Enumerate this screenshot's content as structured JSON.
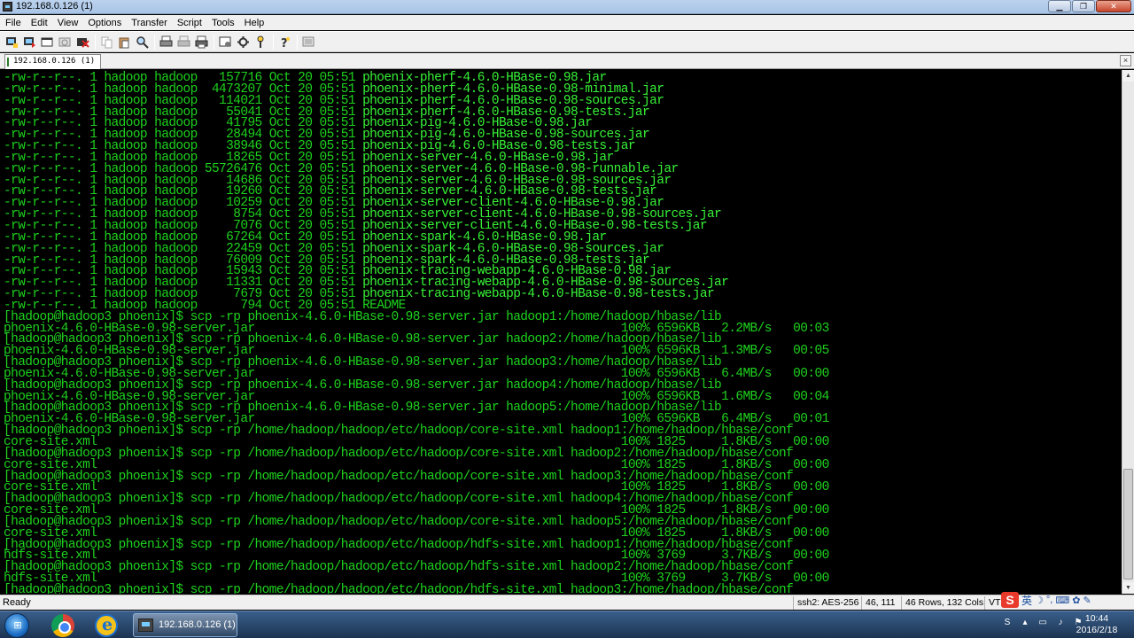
{
  "window": {
    "title": "192.168.0.126 (1)"
  },
  "menu": [
    "File",
    "Edit",
    "View",
    "Options",
    "Transfer",
    "Script",
    "Tools",
    "Help"
  ],
  "toolbar": {
    "icons": [
      "connect-icon",
      "quick-connect-icon",
      "connect-tab-icon",
      "reconnect-icon",
      "disconnect-icon",
      "copy-icon",
      "paste-icon",
      "find-icon",
      "print-icon",
      "print-setup-icon",
      "print-screen-icon",
      "session-options-icon",
      "global-options-icon",
      "keymap-icon",
      "help-icon",
      "sftp-icon"
    ]
  },
  "tab": {
    "label": "192.168.0.126 (1)",
    "close_glyph": "×"
  },
  "terminal": {
    "lines": [
      {
        "plain": "-rw-r--r--. 1 hadoop hadoop   157716 Oct 20 05:51 ",
        "file": "phoenix-pherf-4.6.0-HBase-0.98.jar"
      },
      {
        "plain": "-rw-r--r--. 1 hadoop hadoop  4473207 Oct 20 05:51 ",
        "file": "phoenix-pherf-4.6.0-HBase-0.98-minimal.jar"
      },
      {
        "plain": "-rw-r--r--. 1 hadoop hadoop   114021 Oct 20 05:51 ",
        "file": "phoenix-pherf-4.6.0-HBase-0.98-sources.jar"
      },
      {
        "plain": "-rw-r--r--. 1 hadoop hadoop    55041 Oct 20 05:51 ",
        "file": "phoenix-pherf-4.6.0-HBase-0.98-tests.jar"
      },
      {
        "plain": "-rw-r--r--. 1 hadoop hadoop    41795 Oct 20 05:51 ",
        "file": "phoenix-pig-4.6.0-HBase-0.98.jar"
      },
      {
        "plain": "-rw-r--r--. 1 hadoop hadoop    28494 Oct 20 05:51 ",
        "file": "phoenix-pig-4.6.0-HBase-0.98-sources.jar"
      },
      {
        "plain": "-rw-r--r--. 1 hadoop hadoop    38946 Oct 20 05:51 ",
        "file": "phoenix-pig-4.6.0-HBase-0.98-tests.jar"
      },
      {
        "plain": "-rw-r--r--. 1 hadoop hadoop    18265 Oct 20 05:51 ",
        "file": "phoenix-server-4.6.0-HBase-0.98.jar"
      },
      {
        "plain": "-rw-r--r--. 1 hadoop hadoop 55726476 Oct 20 05:51 ",
        "file": "phoenix-server-4.6.0-HBase-0.98-runnable.jar"
      },
      {
        "plain": "-rw-r--r--. 1 hadoop hadoop    14686 Oct 20 05:51 ",
        "file": "phoenix-server-4.6.0-HBase-0.98-sources.jar"
      },
      {
        "plain": "-rw-r--r--. 1 hadoop hadoop    19260 Oct 20 05:51 ",
        "file": "phoenix-server-4.6.0-HBase-0.98-tests.jar"
      },
      {
        "plain": "-rw-r--r--. 1 hadoop hadoop    10259 Oct 20 05:51 ",
        "file": "phoenix-server-client-4.6.0-HBase-0.98.jar"
      },
      {
        "plain": "-rw-r--r--. 1 hadoop hadoop     8754 Oct 20 05:51 ",
        "file": "phoenix-server-client-4.6.0-HBase-0.98-sources.jar"
      },
      {
        "plain": "-rw-r--r--. 1 hadoop hadoop     7076 Oct 20 05:51 ",
        "file": "phoenix-server-client-4.6.0-HBase-0.98-tests.jar"
      },
      {
        "plain": "-rw-r--r--. 1 hadoop hadoop    67264 Oct 20 05:51 ",
        "file": "phoenix-spark-4.6.0-HBase-0.98.jar"
      },
      {
        "plain": "-rw-r--r--. 1 hadoop hadoop    22459 Oct 20 05:51 ",
        "file": "phoenix-spark-4.6.0-HBase-0.98-sources.jar"
      },
      {
        "plain": "-rw-r--r--. 1 hadoop hadoop    76009 Oct 20 05:51 ",
        "file": "phoenix-spark-4.6.0-HBase-0.98-tests.jar"
      },
      {
        "plain": "-rw-r--r--. 1 hadoop hadoop    15943 Oct 20 05:51 ",
        "file": "phoenix-tracing-webapp-4.6.0-HBase-0.98.jar"
      },
      {
        "plain": "-rw-r--r--. 1 hadoop hadoop    11331 Oct 20 05:51 ",
        "file": "phoenix-tracing-webapp-4.6.0-HBase-0.98-sources.jar"
      },
      {
        "plain": "-rw-r--r--. 1 hadoop hadoop     7679 Oct 20 05:51 ",
        "file": "phoenix-tracing-webapp-4.6.0-HBase-0.98-tests.jar"
      },
      {
        "plain": "-rw-r--r--. 1 hadoop hadoop      794 Oct 20 05:51 README",
        "file": ""
      },
      {
        "plain": "[hadoop@hadoop3 phoenix]$ scp -rp phoenix-4.6.0-HBase-0.98-server.jar hadoop1:/home/hadoop/hbase/lib",
        "file": ""
      },
      {
        "plain": "phoenix-4.6.0-HBase-0.98-server.jar                                                   100% 6596KB   2.2MB/s   00:03",
        "file": ""
      },
      {
        "plain": "[hadoop@hadoop3 phoenix]$ scp -rp phoenix-4.6.0-HBase-0.98-server.jar hadoop2:/home/hadoop/hbase/lib",
        "file": ""
      },
      {
        "plain": "phoenix-4.6.0-HBase-0.98-server.jar                                                   100% 6596KB   1.3MB/s   00:05",
        "file": ""
      },
      {
        "plain": "[hadoop@hadoop3 phoenix]$ scp -rp phoenix-4.6.0-HBase-0.98-server.jar hadoop3:/home/hadoop/hbase/lib",
        "file": ""
      },
      {
        "plain": "phoenix-4.6.0-HBase-0.98-server.jar                                                   100% 6596KB   6.4MB/s   00:00",
        "file": ""
      },
      {
        "plain": "[hadoop@hadoop3 phoenix]$ scp -rp phoenix-4.6.0-HBase-0.98-server.jar hadoop4:/home/hadoop/hbase/lib",
        "file": ""
      },
      {
        "plain": "phoenix-4.6.0-HBase-0.98-server.jar                                                   100% 6596KB   1.6MB/s   00:04",
        "file": ""
      },
      {
        "plain": "[hadoop@hadoop3 phoenix]$ scp -rp phoenix-4.6.0-HBase-0.98-server.jar hadoop5:/home/hadoop/hbase/lib",
        "file": ""
      },
      {
        "plain": "phoenix-4.6.0-HBase-0.98-server.jar                                                   100% 6596KB   6.4MB/s   00:01",
        "file": ""
      },
      {
        "plain": "[hadoop@hadoop3 phoenix]$ scp -rp /home/hadoop/hadoop/etc/hadoop/core-site.xml hadoop1:/home/hadoop/hbase/conf",
        "file": ""
      },
      {
        "plain": "core-site.xml                                                                         100% 1825     1.8KB/s   00:00",
        "file": ""
      },
      {
        "plain": "[hadoop@hadoop3 phoenix]$ scp -rp /home/hadoop/hadoop/etc/hadoop/core-site.xml hadoop2:/home/hadoop/hbase/conf",
        "file": ""
      },
      {
        "plain": "core-site.xml                                                                         100% 1825     1.8KB/s   00:00",
        "file": ""
      },
      {
        "plain": "[hadoop@hadoop3 phoenix]$ scp -rp /home/hadoop/hadoop/etc/hadoop/core-site.xml hadoop3:/home/hadoop/hbase/conf",
        "file": ""
      },
      {
        "plain": "core-site.xml                                                                         100% 1825     1.8KB/s   00:00",
        "file": ""
      },
      {
        "plain": "[hadoop@hadoop3 phoenix]$ scp -rp /home/hadoop/hadoop/etc/hadoop/core-site.xml hadoop4:/home/hadoop/hbase/conf",
        "file": ""
      },
      {
        "plain": "core-site.xml                                                                         100% 1825     1.8KB/s   00:00",
        "file": ""
      },
      {
        "plain": "[hadoop@hadoop3 phoenix]$ scp -rp /home/hadoop/hadoop/etc/hadoop/core-site.xml hadoop5:/home/hadoop/hbase/conf",
        "file": ""
      },
      {
        "plain": "core-site.xml                                                                         100% 1825     1.8KB/s   00:00",
        "file": ""
      },
      {
        "plain": "[hadoop@hadoop3 phoenix]$ scp -rp /home/hadoop/hadoop/etc/hadoop/hdfs-site.xml hadoop1:/home/hadoop/hbase/conf",
        "file": ""
      },
      {
        "plain": "hdfs-site.xml                                                                         100% 3769     3.7KB/s   00:00",
        "file": ""
      },
      {
        "plain": "[hadoop@hadoop3 phoenix]$ scp -rp /home/hadoop/hadoop/etc/hadoop/hdfs-site.xml hadoop2:/home/hadoop/hbase/conf",
        "file": ""
      },
      {
        "plain": "hdfs-site.xml                                                                         100% 3769     3.7KB/s   00:00",
        "file": ""
      },
      {
        "plain": "[hadoop@hadoop3 phoenix]$ scp -rp /home/hadoop/hadoop/etc/hadoop/hdfs-site.xml hadoop3:/home/hadoop/hbase/conf",
        "file": ""
      }
    ]
  },
  "status": {
    "ready": "Ready",
    "cipher": "ssh2: AES-256",
    "cursor": "46, 111",
    "size": "46 Rows, 132 Cols",
    "term_type": "VT1"
  },
  "ime": {
    "logo": "S",
    "lang": "英"
  },
  "taskbar": {
    "crt_label": "192.168.0.126 (1)",
    "clock_time": "10:44",
    "clock_date": "2016/2/18"
  },
  "colors": {
    "terminal_fg": "#1ed21e",
    "terminal_file": "#37f237",
    "terminal_bg": "#000000"
  }
}
